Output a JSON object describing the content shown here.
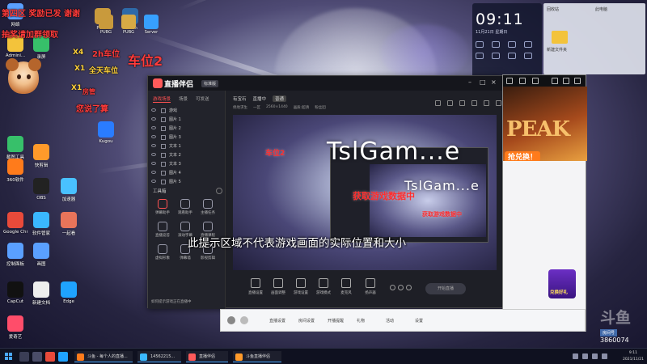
{
  "desktop": {
    "overlay_lines": [
      {
        "text": "第四区 奖励已发 谢谢",
        "color": "#ff3b3b"
      },
      {
        "text": "抽奖请加群领取",
        "color": "#ff3b3b"
      },
      {
        "text": "车位2",
        "color": "#ff3b3b"
      },
      {
        "text": "2h车位",
        "color": "#ff3b3b"
      },
      {
        "text": "X4",
        "color": "#ffd23b"
      },
      {
        "text": "X1",
        "color": "#ffd23b"
      },
      {
        "text": "全天车位",
        "color": "#ffd23b"
      },
      {
        "text": "X1",
        "color": "#ffd23b"
      },
      {
        "text": "房管",
        "color": "#ff3b3b"
      },
      {
        "text": "您说了算",
        "color": "#ff3b3b"
      }
    ],
    "icons": [
      {
        "label": "网络",
        "color": "#5aa0ff"
      },
      {
        "label": "Admini...",
        "color": "#f3c33b"
      },
      {
        "label": "截图工具",
        "color": "#37c06a"
      },
      {
        "label": "360软件",
        "color": "#ff7b1b"
      },
      {
        "label": "Google Chrome",
        "color": "#e84a3a"
      },
      {
        "label": "控制面板",
        "color": "#5aa0ff"
      },
      {
        "label": "CapCut",
        "color": "#111111"
      },
      {
        "label": "爱奇艺",
        "color": "#ff4d6a"
      },
      {
        "label": "录屏",
        "color": "#37c06a"
      },
      {
        "label": "Kugou",
        "color": "#2a7cff"
      },
      {
        "label": "快剪辑",
        "color": "#ff9a2a"
      },
      {
        "label": "OBS",
        "color": "#222222"
      },
      {
        "label": "软件管家",
        "color": "#3ab8ff"
      },
      {
        "label": "画图",
        "color": "#5aa0ff"
      },
      {
        "label": "一起看",
        "color": "#e8745a"
      },
      {
        "label": "新建文档",
        "color": "#eeeeee"
      },
      {
        "label": "Edge",
        "color": "#1fa3ff"
      },
      {
        "label": "PUBG",
        "color": "#c99a3c"
      },
      {
        "label": "Steam",
        "color": "#2e6aa8"
      },
      {
        "label": "加速器",
        "color": "#49c1ff"
      }
    ],
    "top_apps": [
      "PUBG",
      "PUBG",
      "Server",
      "加速器"
    ]
  },
  "clock_widget": {
    "time": "09:11",
    "date": "11月21日 星期日"
  },
  "explorer": {
    "labels": [
      "回收站",
      "此电脑",
      "新建文件夹"
    ]
  },
  "main_window": {
    "app_name": "直播伴侣",
    "badge": "标准版",
    "sidebar": {
      "tabs": [
        "游戏场景",
        "场景",
        "可发送"
      ],
      "scenes": [
        "游戏",
        "图片 1",
        "图片 2",
        "图片 3",
        "文本 1",
        "文本 2",
        "文本 3",
        "图片 4",
        "图片 5"
      ],
      "tools_header": "工具箱",
      "tools": [
        {
          "label": "弹幕助手",
          "active": true
        },
        {
          "label": "观看助手",
          "active": false
        },
        {
          "label": "主播任务",
          "active": false
        },
        {
          "label": "直播竞答",
          "active": false
        },
        {
          "label": "滚动字幕",
          "active": false
        },
        {
          "label": "直播课程",
          "active": false
        },
        {
          "label": "虚拟形象",
          "active": false
        },
        {
          "label": "弹幕墙",
          "active": false
        },
        {
          "label": "影视剪辑",
          "active": false
        }
      ],
      "bottom_text": "如何提示游戏正在直播中"
    },
    "content": {
      "tabs": [
        "有宝石",
        "直播中",
        "普通"
      ],
      "sub_info": [
        "绝地求生",
        "一区",
        "2560×1440",
        "画质:超清",
        "粉丝团"
      ],
      "preview_title": "TslGam...e",
      "preview_title_small": "TslGam...e",
      "preview_red": "获取游戏数据中",
      "preview_red_small": "获取游戏数据中",
      "preview_overlay_small": "车位2",
      "toolbar": [
        "直播设置",
        "画面调整",
        "游戏设置",
        "游戏模式",
        "麦克风",
        "扬声器",
        "摄像头",
        "录屏",
        "设置"
      ],
      "start_button": "开始直播"
    }
  },
  "caption": "此提示区域不代表游戏画面的实际位置和大小",
  "game_window": {
    "banner_big": "PEAK",
    "banner_pill": "抢兑换！",
    "ad_text": "兑换好礼"
  },
  "room_bar": {
    "items": [
      "直播设置",
      "房间设置",
      "开播提醒",
      "礼物",
      "活动",
      "设置"
    ]
  },
  "watermark": {
    "logo": "斗鱼",
    "room_label": "房间号",
    "room_id": "3860074"
  },
  "taskbar": {
    "tasks": [
      {
        "label": "斗鱼 - 每个人的直播...",
        "color": "#ff7b1b"
      },
      {
        "label": "14562215...",
        "color": "#3ab8ff"
      },
      {
        "label": "直播伴侣",
        "color": "#ff5a5a"
      },
      {
        "label": "斗鱼直播伴侣",
        "color": "#ff9a2a"
      }
    ],
    "clock_time": "9:11",
    "clock_date": "2021/11/21"
  },
  "colors": {
    "accent_red": "#ff5252",
    "window_bg": "#1e1f26",
    "taskbar_bg": "#0f1120"
  }
}
